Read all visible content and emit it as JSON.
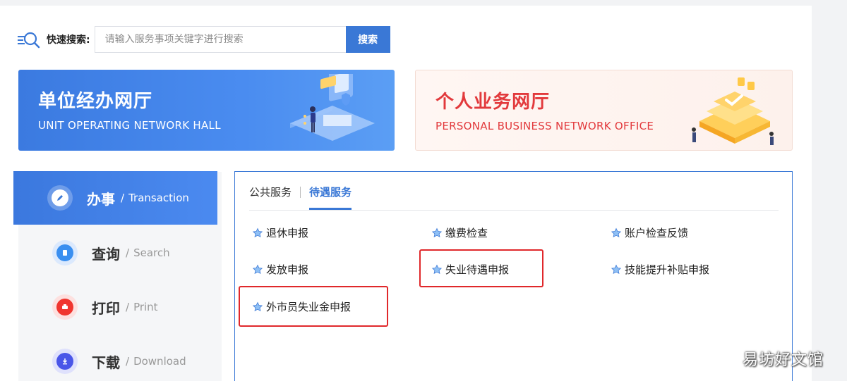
{
  "search": {
    "label": "快速搜索:",
    "placeholder": "请输入服务事项关键字进行搜索",
    "button_label": "搜索"
  },
  "halls": {
    "unit": {
      "title": "单位经办网厅",
      "subtitle": "UNIT OPERATING NETWORK HALL"
    },
    "personal": {
      "title": "个人业务网厅",
      "subtitle": "PERSONAL BUSINESS NETWORK OFFICE"
    }
  },
  "nav": {
    "items": [
      {
        "label": "办事",
        "en": "Transaction",
        "sep": "/",
        "icon": "edit-icon",
        "color": "#ffffff"
      },
      {
        "label": "查询",
        "en": "Search",
        "sep": "/",
        "icon": "document-icon",
        "color": "#3a8ff0"
      },
      {
        "label": "打印",
        "en": "Print",
        "sep": "/",
        "icon": "printer-icon",
        "color": "#f0352f"
      },
      {
        "label": "下载",
        "en": "Download",
        "sep": "/",
        "icon": "download-icon",
        "color": "#4a56e8"
      }
    ]
  },
  "tabs": [
    {
      "label": "公共服务"
    },
    {
      "label": "待遇服务"
    }
  ],
  "services": [
    {
      "label": "退休申报"
    },
    {
      "label": "缴费检查"
    },
    {
      "label": "账户检查反馈"
    },
    {
      "label": "发放申报"
    },
    {
      "label": "失业待遇申报"
    },
    {
      "label": "技能提升补贴申报"
    },
    {
      "label": "外市员失业金申报"
    }
  ],
  "watermark": "易坊好文馆",
  "colors": {
    "primary": "#3a78d6",
    "highlight": "#e0282b",
    "personal": "#e2393c"
  }
}
